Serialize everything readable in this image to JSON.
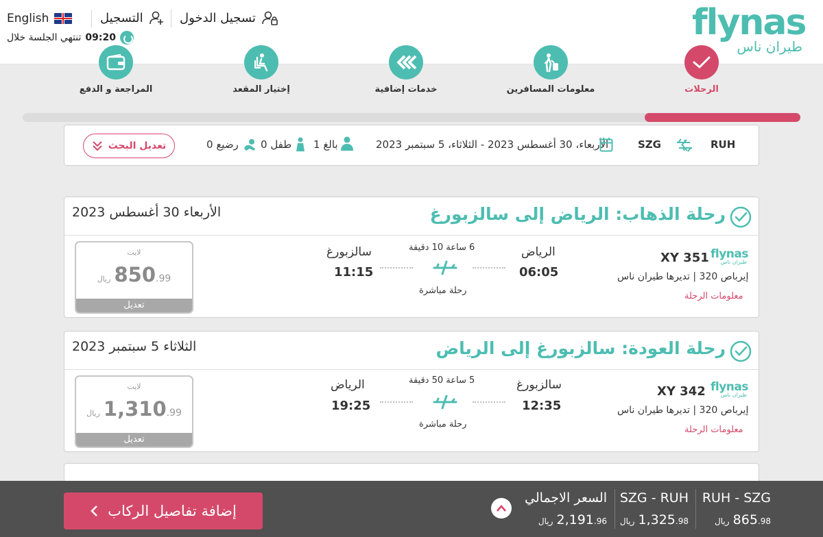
{
  "header": {
    "language": "English",
    "register": "التسجيل",
    "login": "تسجيل الدخول",
    "session_label": "تنتهي الجلسة خلال",
    "session_time": "09:20",
    "logo_en": "flynas",
    "logo_ar": "طيران ناس"
  },
  "steps": [
    {
      "label": "الرحلات",
      "active": true,
      "icon": "check-icon"
    },
    {
      "label": "معلومات المسافرين",
      "active": false,
      "icon": "traveler-icon"
    },
    {
      "label": "خدمات إضافية",
      "active": false,
      "icon": "services-icon"
    },
    {
      "label": "إختيار المقعد",
      "active": false,
      "icon": "seat-icon"
    },
    {
      "label": "المراجعة و الدفع",
      "active": false,
      "icon": "wallet-icon"
    }
  ],
  "progress": 0.2,
  "search": {
    "origin": "RUH",
    "destination": "SZG",
    "dates": "الأربعاء، 30 أغسطس 2023 - الثلاثاء، 5 سبتمبر 2023",
    "adults": "1 بالغ",
    "children": "0 طفل",
    "infants": "0 رضيع",
    "edit_label": "تعديل البحث"
  },
  "flights": [
    {
      "title": "رحلة الذهاب: الرياض إلى سالزبورغ",
      "date": "الأربعاء 30 أغسطس 2023",
      "flight_no": "XY 351",
      "aircraft": "إيرباص 320 | تديرها طيران ناس",
      "info_link": "معلومات الرحلة",
      "dep_city": "الرياض",
      "dep_time": "06:05",
      "arr_city": "سالزبورغ",
      "arr_time": "11:15",
      "duration": "6 ساعة 10 دقيقة",
      "stops": "رحلة مباشرة",
      "fare_tier": "لايت",
      "fare_amount": "850",
      "fare_decimals": ".99",
      "fare_currency": "ريال",
      "modify_label": "تعديل"
    },
    {
      "title": "رحلة العودة: سالزبورغ إلى الرياض",
      "date": "الثلاثاء 5 سبتمبر 2023",
      "flight_no": "XY 342",
      "aircraft": "إيرباص 320 | تديرها طيران ناس",
      "info_link": "معلومات الرحلة",
      "dep_city": "سالزبورغ",
      "dep_time": "12:35",
      "arr_city": "الرياض",
      "arr_time": "19:25",
      "duration": "5 ساعة 50 دقيقة",
      "stops": "رحلة مباشرة",
      "fare_tier": "لايت",
      "fare_amount": "1,310",
      "fare_decimals": ".99",
      "fare_currency": "ريال",
      "modify_label": "تعديل"
    }
  ],
  "summary": {
    "cta_label": "إضافة تفاصيل الركاب",
    "total_label": "السعر الاجمالي",
    "total_amount": "2,191",
    "total_decimals": ".96",
    "leg1_label": "RUH - SZG",
    "leg1_amount": "865",
    "leg1_decimals": ".98",
    "leg2_label": "SZG - RUH",
    "leg2_amount": "1,325",
    "leg2_decimals": ".98",
    "currency": "ريال"
  },
  "colors": {
    "teal": "#4dbdb1",
    "pink": "#d4496a",
    "bar": "#505050"
  }
}
